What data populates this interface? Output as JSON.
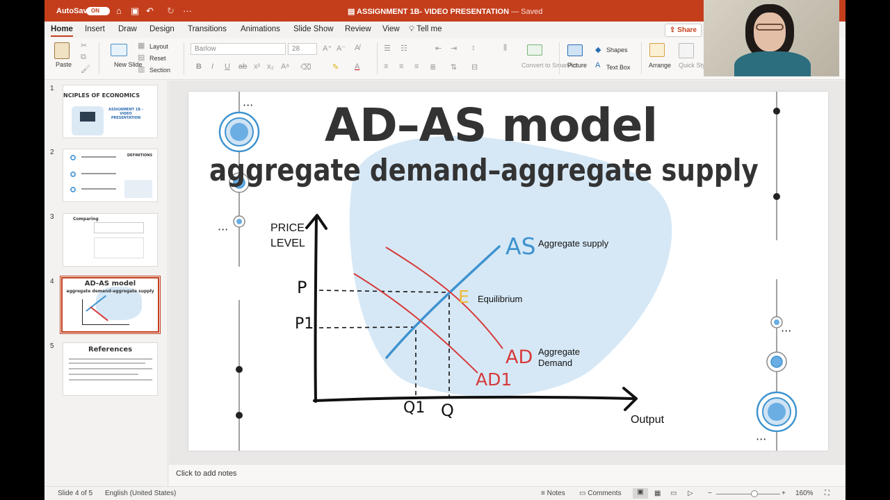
{
  "titlebar": {
    "autosave_label": "AutoSave",
    "autosave_state": "ON",
    "doc_name": "ASSIGNMENT 1B- VIDEO PRESENTATION",
    "saved_label": "— Saved"
  },
  "tabs": {
    "items": [
      "Home",
      "Insert",
      "Draw",
      "Design",
      "Transitions",
      "Animations",
      "Slide Show",
      "Review",
      "View",
      "Tell me"
    ],
    "active": "Home",
    "share_label": "Share"
  },
  "ribbon": {
    "paste": "Paste",
    "new_slide": "New Slide",
    "layout": "Layout",
    "reset": "Reset",
    "section": "Section",
    "font_name": "Barlow",
    "font_size": "28",
    "convert_smartart": "Convert to SmartArt",
    "picture": "Picture",
    "shapes": "Shapes",
    "text_box": "Text Box",
    "arrange": "Arrange",
    "quick_styles": "Quick Styles"
  },
  "thumbnails": [
    {
      "num": "1",
      "title": "PRINCIPLES OF ECONOMICS",
      "sub": "ASSIGNMENT 1B - VIDEO PRESENTATION"
    },
    {
      "num": "2",
      "title": "DEFINITIONS",
      "sub": ""
    },
    {
      "num": "3",
      "title": "Comparing",
      "sub": ""
    },
    {
      "num": "4",
      "title": "AD-AS model",
      "sub": "aggregate demand-aggregate supply"
    },
    {
      "num": "5",
      "title": "References",
      "sub": ""
    }
  ],
  "slide": {
    "title": "AD–AS model",
    "subtitle": "aggregate demand–aggregate supply",
    "y_axis_label": "PRICE LEVEL",
    "x_axis_label": "Output",
    "as_tag": "AS",
    "as_label": "Aggregate supply",
    "eq_tag": "E",
    "eq_label": "Equilibrium",
    "ad_tag": "AD",
    "ad_label": "Aggregate Demand",
    "ad1_tag": "AD1",
    "p_label": "P",
    "p1_label": "P1",
    "q_label": "Q",
    "q1_label": "Q1"
  },
  "notes_placeholder": "Click to add notes",
  "status": {
    "slide_info": "Slide 4 of 5",
    "language": "English (United States)",
    "notes": "Notes",
    "comments": "Comments",
    "zoom": "160%"
  },
  "colors": {
    "accent": "#c43e1c",
    "blob": "#d6e8f6",
    "as_line": "#3f93cf",
    "ad_line": "#d63a3a",
    "eq_marker": "#f0b93a"
  }
}
